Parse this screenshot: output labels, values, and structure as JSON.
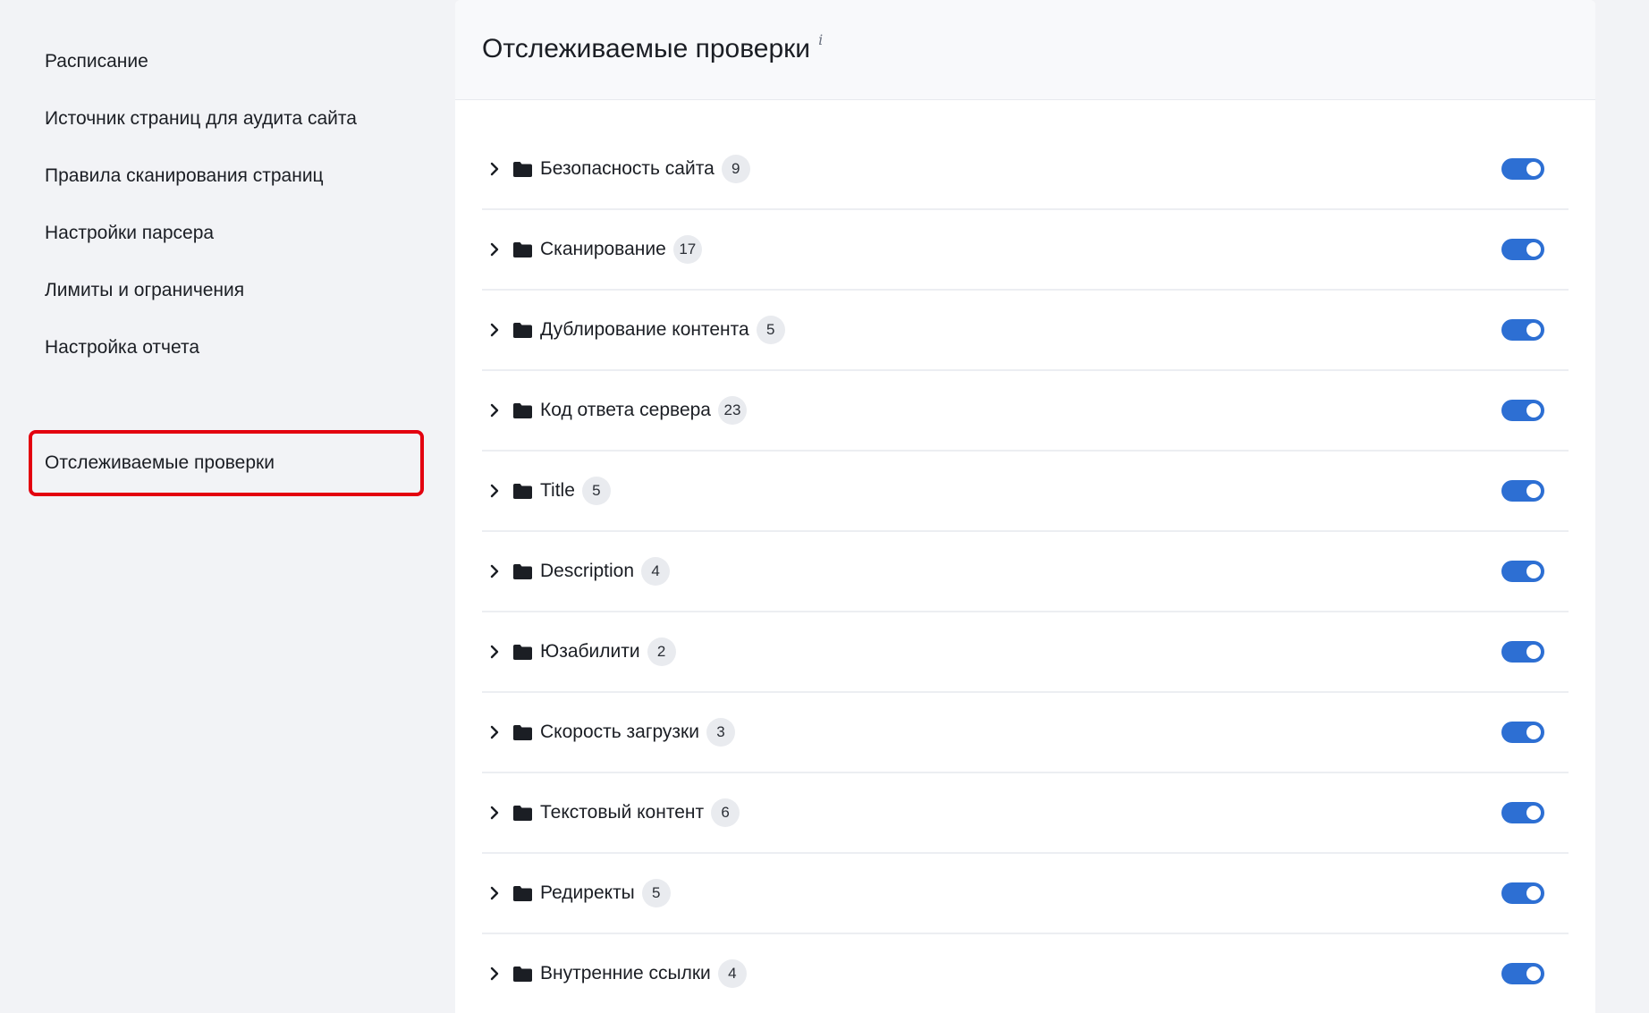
{
  "sidebar": {
    "items": [
      {
        "label": "Расписание",
        "active": false
      },
      {
        "label": "Источник страниц для аудита сайта",
        "active": false
      },
      {
        "label": "Правила сканирования страниц",
        "active": false
      },
      {
        "label": "Настройки парсера",
        "active": false
      },
      {
        "label": "Лимиты и ограничения",
        "active": false
      },
      {
        "label": "Настройка отчета",
        "active": false
      },
      {
        "label": "Отслеживаемые проверки",
        "active": true
      }
    ]
  },
  "main": {
    "title": "Отслеживаемые проверки",
    "info_glyph": "i",
    "groups": [
      {
        "name": "Безопасность сайта",
        "count": "9",
        "enabled": true
      },
      {
        "name": "Сканирование",
        "count": "17",
        "enabled": true
      },
      {
        "name": "Дублирование контента",
        "count": "5",
        "enabled": true
      },
      {
        "name": "Код ответа сервера",
        "count": "23",
        "enabled": true
      },
      {
        "name": "Title",
        "count": "5",
        "enabled": true
      },
      {
        "name": "Description",
        "count": "4",
        "enabled": true
      },
      {
        "name": "Юзабилити",
        "count": "2",
        "enabled": true
      },
      {
        "name": "Скорость загрузки",
        "count": "3",
        "enabled": true
      },
      {
        "name": "Текстовый контент",
        "count": "6",
        "enabled": true
      },
      {
        "name": "Редиректы",
        "count": "5",
        "enabled": true
      },
      {
        "name": "Внутренние ссылки",
        "count": "4",
        "enabled": true
      }
    ]
  },
  "colors": {
    "background": "#f2f3f6",
    "card": "#ffffff",
    "header": "#f8f9fb",
    "toggle_on": "#2d6fd3",
    "active_outline": "#e3000f",
    "badge": "#e9ebef",
    "text": "#1b1e24"
  },
  "icons": {
    "expand": "chevron-right-icon",
    "group": "folder-icon",
    "info": "info-icon"
  }
}
